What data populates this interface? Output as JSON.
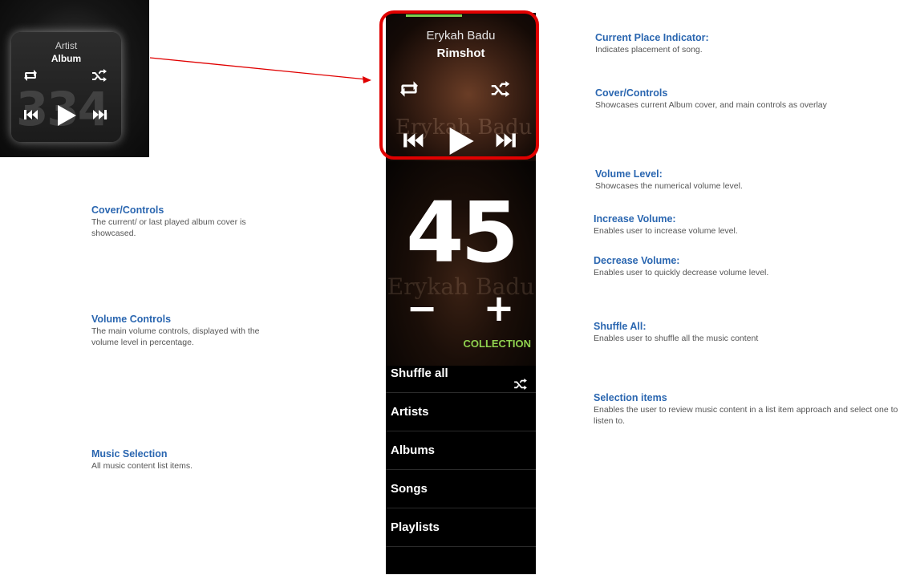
{
  "thumbnail": {
    "artist": "Artist",
    "album": "Album",
    "background_number": "334",
    "icons": [
      "repeat-icon",
      "shuffle-icon",
      "previous-icon",
      "play-icon",
      "next-icon"
    ]
  },
  "player": {
    "artist": "Erykah Badu",
    "album": "Rimshot",
    "cover_watermark": "Erykah Badu",
    "progress_fraction": 0.37,
    "icons": [
      "repeat-icon",
      "shuffle-icon",
      "previous-icon",
      "play-icon",
      "next-icon"
    ]
  },
  "volume": {
    "level": "45",
    "watermark": "Erykah Badu",
    "decrease_label": "−",
    "increase_label": "+"
  },
  "collection": {
    "label": "COLLECTION",
    "items": [
      {
        "label": "Shuffle all",
        "icon": "shuffle-icon"
      },
      {
        "label": "Artists"
      },
      {
        "label": "Albums"
      },
      {
        "label": "Songs"
      },
      {
        "label": "Playlists"
      }
    ]
  },
  "annotations_left": [
    {
      "title": "Cover/Controls",
      "desc": "The current/ or last played album cover is showcased."
    },
    {
      "title": "Volume Controls",
      "desc": "The main volume controls, displayed with the volume level in percentage."
    },
    {
      "title": "Music Selection",
      "desc": "All music content list items."
    }
  ],
  "annotations_right": [
    {
      "title": "Current Place Indicator:",
      "desc": "Indicates placement of song."
    },
    {
      "title": "Cover/Controls",
      "desc": "Showcases current Album cover, and main controls as overlay"
    },
    {
      "title": "Volume Level:",
      "desc": "Showcases the numerical volume level."
    },
    {
      "title": "Increase Volume:",
      "desc": "Enables user to increase volume level."
    },
    {
      "title": "Decrease Volume:",
      "desc": "Enables user to quickly decrease volume level."
    },
    {
      "title": "Shuffle All:",
      "desc": "Enables user to shuffle all the music content"
    },
    {
      "title": "Selection items",
      "desc": "Enables the user to review music content in a list item approach and select one to listen to."
    }
  ],
  "colors": {
    "annotation_title": "#2a66b0",
    "highlight": "#e00000",
    "progress": "#7ed14f",
    "collection_label": "#8fd14f"
  }
}
